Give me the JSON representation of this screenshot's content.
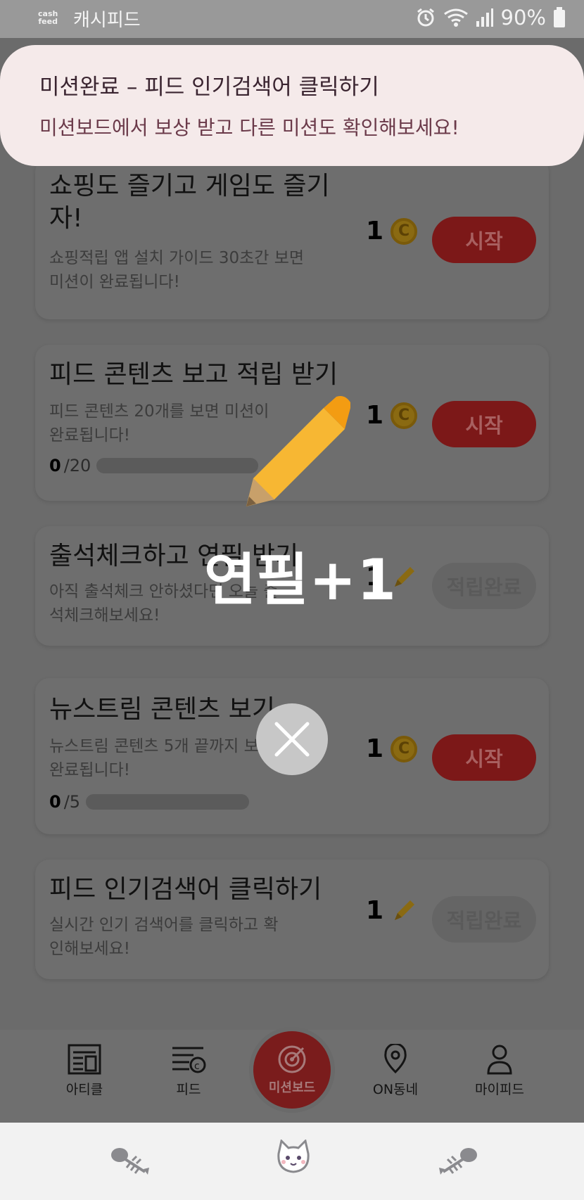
{
  "status": {
    "app_logo_line1": "cash",
    "app_logo_line2": "feed",
    "app_name": "캐시피드",
    "battery": "90%"
  },
  "toast": {
    "title": "미션완료 – 피드 인기검색어 클릭하기",
    "message": "미션보드에서 보상 받고 다른 미션도 확인해보세요!"
  },
  "missions": [
    {
      "title": "쇼핑도 즐기고 게임도 즐기자!",
      "desc": "쇼핑적립 앱 설치 가이드 30초간 보면 미션이 완료됩니다!",
      "reward": "1",
      "reward_icon": "coin-icon",
      "coin_letter": "C",
      "button": "시작"
    },
    {
      "title": "피드 콘텐츠 보고 적립 받기",
      "desc": "피드 콘텐츠 20개를 보면 미션이 완료됩니다!",
      "progress_current": "0",
      "progress_total": "/20",
      "progress_fraction": 0,
      "reward": "1",
      "reward_icon": "coin-icon",
      "coin_letter": "C",
      "button": "시작"
    },
    {
      "title": "출석체크하고 연필 받기",
      "desc": "아직 출석체크 안하셨다면 오늘 출석체크해보세요!",
      "reward": "1",
      "reward_icon": "pencil-icon",
      "button": "적립완료"
    },
    {
      "title": "뉴스트림 콘텐츠 보기",
      "desc": "뉴스트림 콘텐츠 5개 끝까지 보면 완료됩니다!",
      "progress_current": "0",
      "progress_total": "/5",
      "progress_fraction": 0,
      "reward": "1",
      "reward_icon": "coin-icon",
      "coin_letter": "C",
      "button": "시작"
    },
    {
      "title": "피드 인기검색어 클릭하기",
      "desc": "실시간 인기 검색어를 클릭하고 확인해보세요!",
      "reward": "1",
      "reward_icon": "pencil-icon",
      "button": "적립완료"
    }
  ],
  "overlay": {
    "reward_text": "연필+1"
  },
  "nav": {
    "items": [
      {
        "label": "아티클",
        "icon": "article-icon"
      },
      {
        "label": "피드",
        "icon": "feed-icon"
      },
      {
        "label": "미션보드",
        "icon": "target-icon"
      },
      {
        "label": "ON동네",
        "icon": "location-icon"
      },
      {
        "label": "마이피드",
        "icon": "person-icon"
      }
    ]
  },
  "colors": {
    "accent": "#c62828",
    "coin": "#e0a818",
    "toast_bg": "#f5eaea"
  }
}
